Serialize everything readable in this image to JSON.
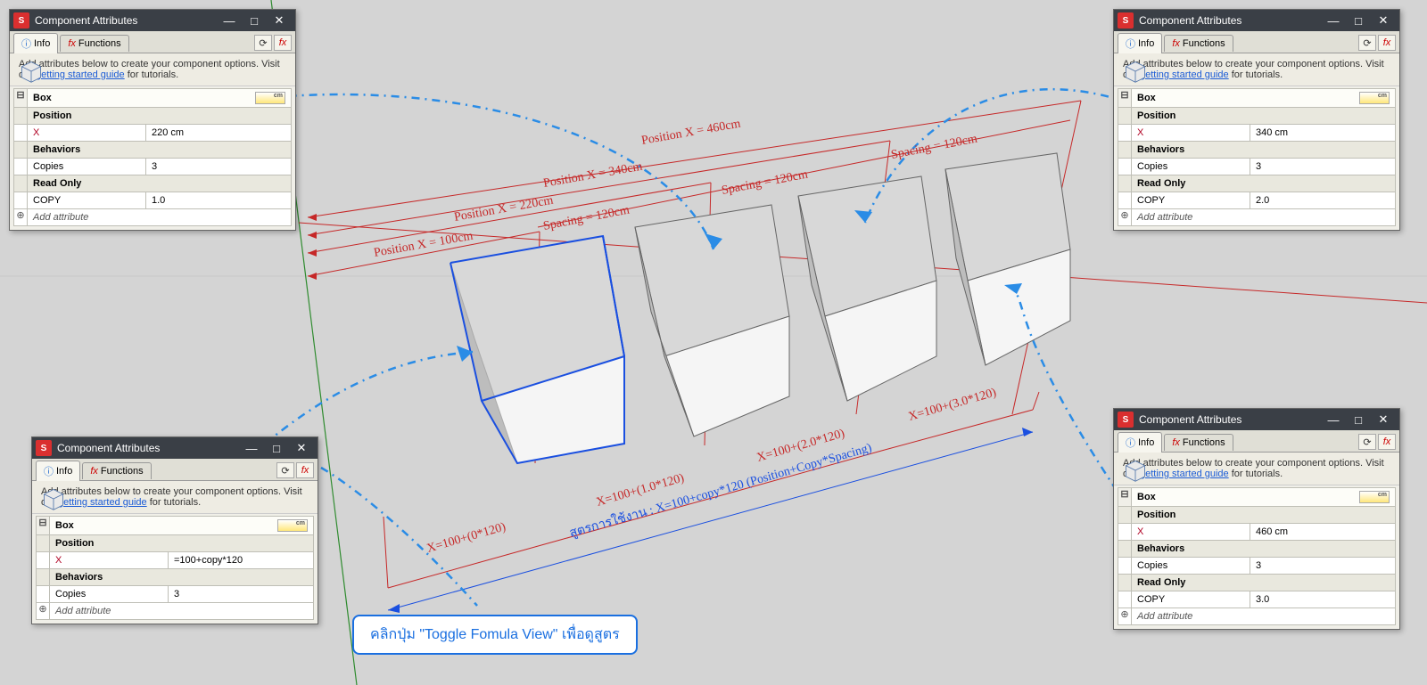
{
  "window_title": "Component Attributes",
  "tabs": {
    "info": "Info",
    "functions": "Functions"
  },
  "intro": {
    "text1": "Add attributes below to create your component options. Visit our ",
    "link": "getting started guide",
    "text2": " for tutorials."
  },
  "ruler_unit": "cm",
  "sections": {
    "position": "Position",
    "behaviors": "Behaviors",
    "readonly": "Read Only"
  },
  "labels": {
    "x": "X",
    "copies": "Copies",
    "copy": "COPY",
    "add": "Add attribute",
    "box": "Box"
  },
  "panels": {
    "p1": {
      "x": "220 cm",
      "copies": "3",
      "copy": "1.0"
    },
    "p2": {
      "x": "=100+copy*120",
      "copies": "3"
    },
    "p3": {
      "x": "340 cm",
      "copies": "3",
      "copy": "2.0"
    },
    "p4": {
      "x": "460 cm",
      "copies": "3",
      "copy": "3.0"
    }
  },
  "scene": {
    "pos1": "Position X = 100cm",
    "pos2": "Position X = 220cm",
    "pos3": "Position X = 340cm",
    "pos4": "Position X = 460cm",
    "sp1": "Spacing = 120cm",
    "sp2": "Spacing = 120cm",
    "sp3": "Spacing = 120cm",
    "f0": "X=100+(0*120)",
    "f1": "X=100+(1.0*120)",
    "f2": "X=100+(2.0*120)",
    "f3": "X=100+(3.0*120)",
    "formula": "สูตรการใช้งาน : X=100+copy*120 (Position+Copy*Spacing)"
  },
  "callout": "คลิกปุ่ม \"Toggle Fomula View\" เพื่อดูสูตร"
}
